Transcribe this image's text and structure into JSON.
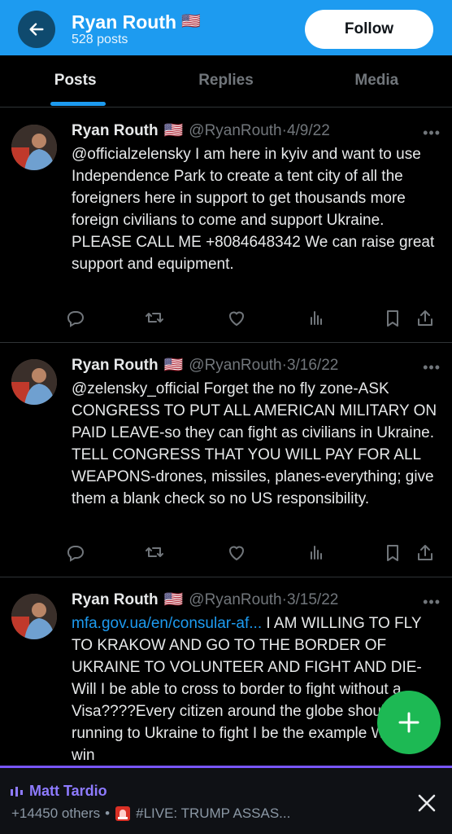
{
  "header": {
    "name": "Ryan Routh",
    "flag": "🇺🇸",
    "posts_count": "528 posts",
    "follow_label": "Follow"
  },
  "tabs": [
    {
      "label": "Posts",
      "active": true
    },
    {
      "label": "Replies",
      "active": false
    },
    {
      "label": "Media",
      "active": false
    }
  ],
  "tweets": [
    {
      "name": "Ryan Routh",
      "flag": "🇺🇸",
      "handle": "@RyanRouth",
      "date": "4/9/22",
      "link": "",
      "text": "@officialzelensky I am here in kyiv and want to use Independence Park to create a tent city of all the foreigners here in support to get thousands more foreign civilians to come and support Ukraine. PLEASE CALL ME +8084648342 We can raise great support and equipment."
    },
    {
      "name": "Ryan Routh",
      "flag": "🇺🇸",
      "handle": "@RyanRouth",
      "date": "3/16/22",
      "link": "",
      "text": "@zelensky_official Forget the no fly zone-ASK CONGRESS TO PUT ALL AMERICAN MILITARY ON PAID LEAVE-so they can fight as civilians in Ukraine.  TELL CONGRESS THAT YOU WILL PAY FOR ALL WEAPONS-drones, missiles, planes-everything; give them a blank check so no US responsibility."
    },
    {
      "name": "Ryan Routh",
      "flag": "🇺🇸",
      "handle": "@RyanRouth",
      "date": "3/15/22",
      "link": "mfa.gov.ua/en/consular-af...",
      "text": " I AM WILLING TO FLY TO KRAKOW AND GO TO THE BORDER OF UKRAINE TO VOLUNTEER AND FIGHT AND DIE-Will I be able to cross to border to fight without a Visa????Every citizen around the globe should be running to Ukraine to fight I be the example We must win"
    }
  ],
  "space_bar": {
    "host": "Matt Tardio",
    "listeners": "+14450 others",
    "separator": "•",
    "live_title": "#LIVE: TRUMP ASSAS..."
  },
  "colors": {
    "accent": "#1d9bf0",
    "space_purple": "#7856ff",
    "fab_green": "#1db954"
  },
  "icons": {
    "back": "arrow-left-icon",
    "more": "more-dots-icon",
    "reply": "reply-icon",
    "retweet": "retweet-icon",
    "like": "heart-icon",
    "views": "analytics-icon",
    "bookmark": "bookmark-icon",
    "share": "share-icon",
    "compose": "plus-icon",
    "close": "close-icon"
  }
}
